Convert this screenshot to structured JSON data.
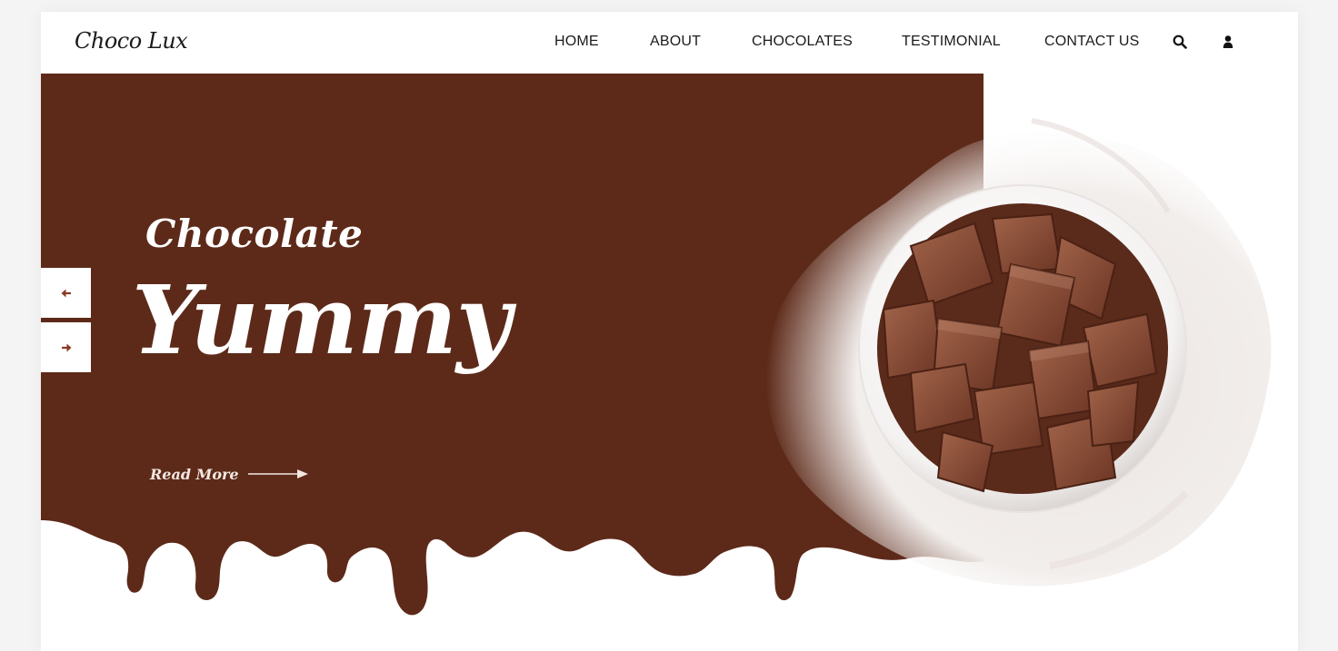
{
  "brand": {
    "logo_text": "Choco Lux"
  },
  "nav": {
    "items": [
      "HOME",
      "ABOUT",
      "CHOCOLATES",
      "TESTIMONIAL",
      "CONTACT US"
    ]
  },
  "header_icons": [
    "search-icon",
    "user-icon"
  ],
  "hero": {
    "script_title": "Chocolate",
    "big_title": "Yummy",
    "read_more_label": "Read More"
  },
  "slider_controls": {
    "prev_icon": "arrow-left-icon",
    "next_icon": "arrow-right-icon"
  },
  "colors": {
    "chocolate": "#5d2a19",
    "white": "#ffffff",
    "text_dark": "#1b1b1b",
    "arrow_accent": "#8a3b24"
  }
}
